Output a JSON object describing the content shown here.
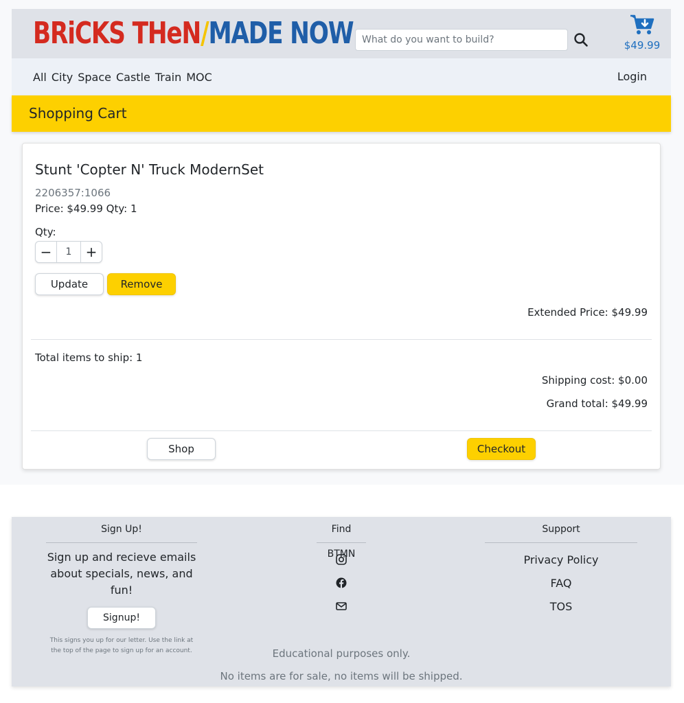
{
  "brand": {
    "part1": "BRiCKS THeN",
    "slash": "/",
    "part2": "MADE NOW",
    "colors": {
      "red": "#d42a1f",
      "yellow": "#f5c400",
      "blue": "#1f5ea8"
    }
  },
  "header": {
    "search_placeholder": "What do you want to build?",
    "search_icon": "magnifier-icon",
    "cart_icon": "shopping-cart-icon",
    "cart_total": "$49.99"
  },
  "nav": {
    "links": [
      "All",
      "City",
      "Space",
      "Castle",
      "Train",
      "MOC"
    ],
    "login": "Login"
  },
  "page": {
    "title": "Shopping Cart"
  },
  "cart": {
    "item": {
      "name": "Stunt 'Copter N' Truck ModernSet",
      "sku": "2206357:1066",
      "price_line": "Price: $49.99 Qty: 1",
      "qty_label": "Qty:",
      "qty_value": "1",
      "minus": "−",
      "plus": "+",
      "update_label": "Update",
      "remove_label": "Remove",
      "extended_price": "Extended Price: $49.99"
    },
    "summary": {
      "total_items": "Total items to ship: 1",
      "shipping": "Shipping cost: $0.00",
      "grand_total": "Grand total: $49.99"
    },
    "actions": {
      "shop_label": "Shop",
      "checkout_label": "Checkout"
    }
  },
  "footer": {
    "signup": {
      "title": "Sign Up!",
      "text": "Sign up and recieve emails about specials, news, and fun!",
      "button": "Signup!",
      "note": "This signs you up for our letter. Use the link at the top of the page to sign up for an account."
    },
    "find": {
      "title": "Find BTMN",
      "icons": [
        "instagram-icon",
        "facebook-icon",
        "envelope-icon"
      ]
    },
    "support": {
      "title": "Support",
      "links": [
        "Privacy Policy",
        "FAQ",
        "TOS"
      ]
    },
    "note1": "Educational purposes only.",
    "note2": "No items are for sale, no items will be shipped."
  }
}
